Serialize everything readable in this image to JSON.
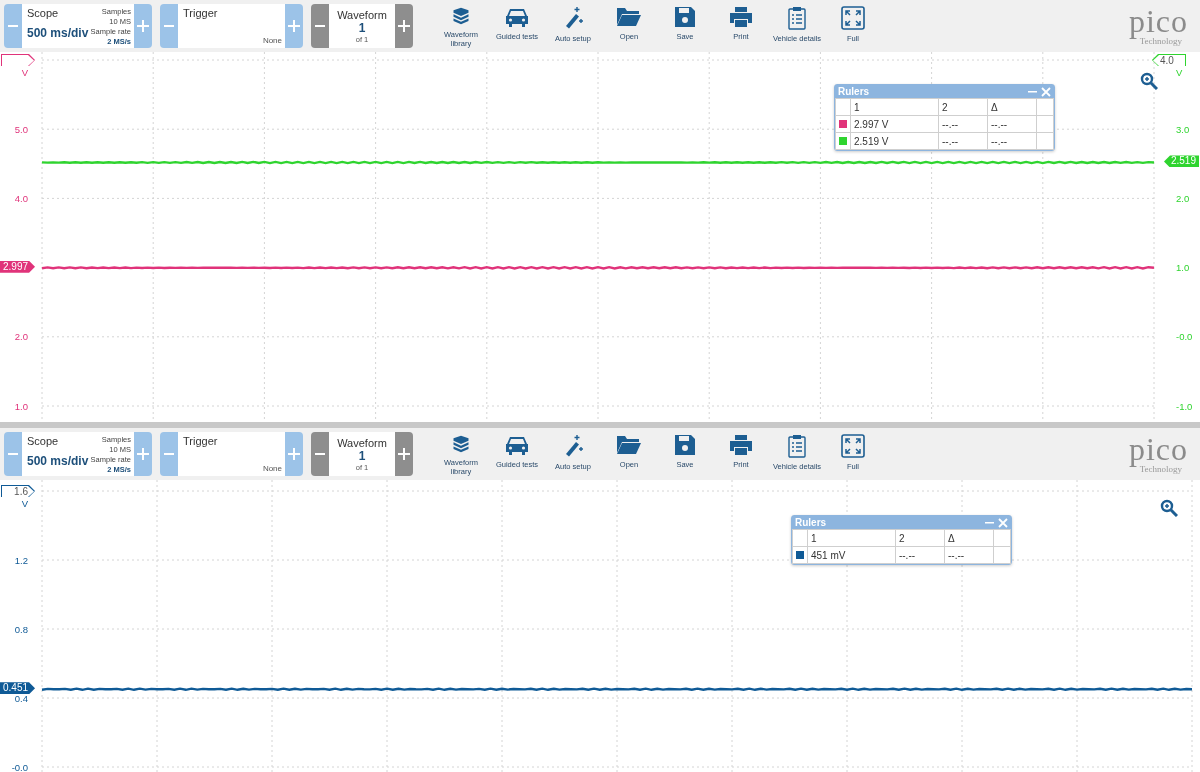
{
  "panes": [
    {
      "toolbar": {
        "scope": {
          "title": "Scope",
          "timebase": "500 ms/div",
          "samples_label": "Samples",
          "samples": "10 MS",
          "rate_label": "Sample rate",
          "rate": "2 MS/s"
        },
        "trigger": {
          "title": "Trigger",
          "mode": "None"
        },
        "waveform": {
          "title": "Waveform",
          "current": "1",
          "total": "of 1",
          "disabled": true
        },
        "buttons": [
          {
            "kind": "library",
            "label": "Waveform library"
          },
          {
            "kind": "car",
            "label": "Guided tests"
          },
          {
            "kind": "wand",
            "label": "Auto setup"
          },
          {
            "kind": "folder",
            "label": "Open"
          },
          {
            "kind": "save",
            "label": "Save"
          },
          {
            "kind": "print",
            "label": "Print"
          },
          {
            "kind": "clipboard",
            "label": "Vehicle details"
          },
          {
            "kind": "full",
            "label": "Full"
          }
        ],
        "logo": {
          "name": "pico",
          "tagline": "Technology"
        }
      },
      "chart_data": {
        "type": "line",
        "grid": true,
        "ylabel": "V",
        "ylim": [
          1,
          6
        ],
        "categories": [
          null,
          null,
          null,
          null,
          null,
          null,
          null,
          null,
          null,
          null,
          null
        ],
        "yticks": [
          {
            "value": 5,
            "label": "5.0"
          },
          {
            "value": 4,
            "label": "4.0"
          },
          {
            "value": 2,
            "label": "2.0"
          },
          {
            "value": 1,
            "label": "1.0"
          }
        ],
        "y2label": "V",
        "y2lim": [
          -1,
          4
        ],
        "y2ticks": [
          {
            "value": 3,
            "label": "3.0"
          },
          {
            "value": 2,
            "label": "2.0"
          },
          {
            "value": 1,
            "label": "1.0"
          },
          {
            "value": 0,
            "label": "-0.0"
          },
          {
            "value": -1,
            "label": "-1.0"
          }
        ],
        "series": [
          {
            "color": "#e0337a",
            "values": [
              2.997,
              2.997,
              2.997,
              2.997,
              2.997,
              2.997,
              2.997,
              2.997,
              2.997,
              2.997,
              2.997
            ]
          },
          {
            "color": "#2fd42f",
            "axis": "y2",
            "values": [
              2.519,
              2.519,
              2.519,
              2.519,
              2.519,
              2.519,
              2.519,
              2.519,
              2.519,
              2.519,
              2.519
            ]
          }
        ],
        "annotations": [
          "2.997",
          "2.519"
        ]
      },
      "right_scale_marker": "4.0",
      "rulers": {
        "title": "Rulers",
        "columns": [
          "1",
          "2",
          "Δ"
        ],
        "rows": [
          {
            "color": "#e0337a",
            "values": [
              "2.997 V",
              "--.--",
              "--.--"
            ]
          },
          {
            "color": "#2fd42f",
            "values": [
              "2.519 V",
              "--.--",
              "--.--"
            ]
          }
        ]
      }
    },
    {
      "toolbar": {
        "scope": {
          "title": "Scope",
          "timebase": "500 ms/div",
          "samples_label": "Samples",
          "samples": "10 MS",
          "rate_label": "Sample rate",
          "rate": "2 MS/s"
        },
        "trigger": {
          "title": "Trigger",
          "mode": "None"
        },
        "waveform": {
          "title": "Waveform",
          "current": "1",
          "total": "of 1",
          "disabled": true
        },
        "buttons": [
          {
            "kind": "library",
            "label": "Waveform library"
          },
          {
            "kind": "car",
            "label": "Guided tests"
          },
          {
            "kind": "wand",
            "label": "Auto setup"
          },
          {
            "kind": "folder",
            "label": "Open"
          },
          {
            "kind": "save",
            "label": "Save"
          },
          {
            "kind": "print",
            "label": "Print"
          },
          {
            "kind": "clipboard",
            "label": "Vehicle details"
          },
          {
            "kind": "full",
            "label": "Full"
          }
        ],
        "logo": {
          "name": "pico",
          "tagline": "Technology"
        }
      },
      "chart_data": {
        "type": "line",
        "grid": true,
        "ylabel": "V",
        "ylim": [
          0,
          1.6
        ],
        "categories": [
          null,
          null,
          null,
          null,
          null,
          null,
          null,
          null,
          null,
          null,
          null
        ],
        "yticks": [
          {
            "value": 1.6,
            "label": "1.6"
          },
          {
            "value": 1.2,
            "label": "1.2"
          },
          {
            "value": 0.8,
            "label": "0.8"
          },
          {
            "value": 0.4,
            "label": "0.4"
          },
          {
            "value": 0,
            "label": "-0.0"
          }
        ],
        "series": [
          {
            "color": "#0f5a96",
            "values": [
              0.451,
              0.451,
              0.451,
              0.451,
              0.451,
              0.451,
              0.451,
              0.451,
              0.451,
              0.451,
              0.451
            ]
          }
        ],
        "annotations": [
          "0.451"
        ]
      },
      "rulers": {
        "title": "Rulers",
        "columns": [
          "1",
          "2",
          "Δ"
        ],
        "rows": [
          {
            "color": "#0f5a96",
            "values": [
              "451 mV",
              "--.--",
              "--.--"
            ]
          }
        ]
      }
    }
  ]
}
